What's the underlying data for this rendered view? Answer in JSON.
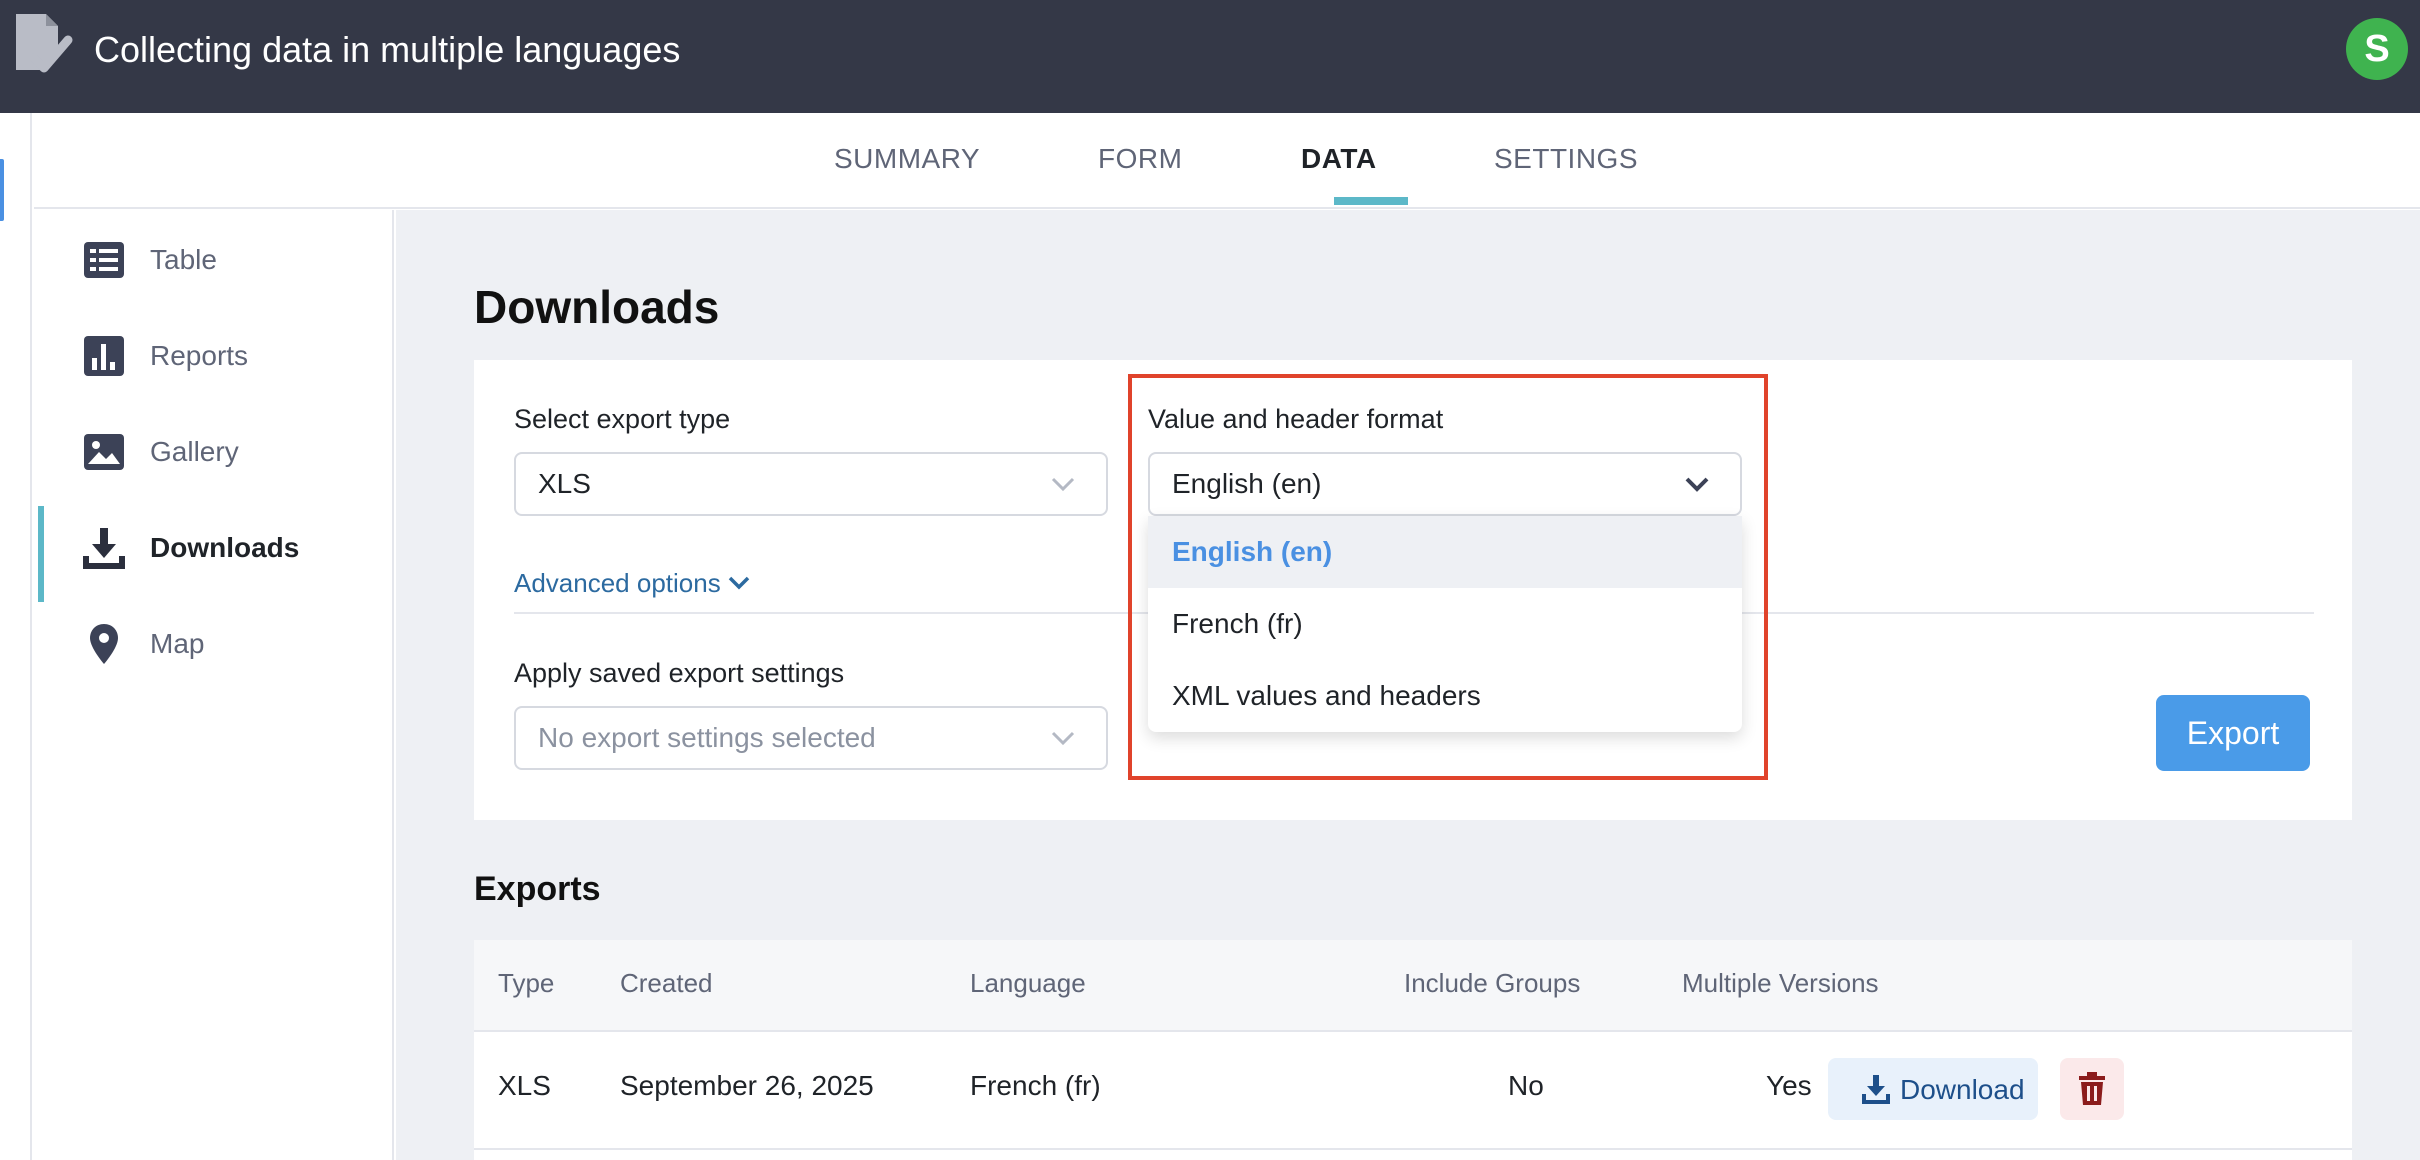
{
  "header": {
    "title": "Collecting data in multiple languages",
    "avatar_initial": "S",
    "logo_icon": "form-checkmark-icon"
  },
  "tabs": [
    {
      "label": "SUMMARY",
      "active": false
    },
    {
      "label": "FORM",
      "active": false
    },
    {
      "label": "DATA",
      "active": true
    },
    {
      "label": "SETTINGS",
      "active": false
    }
  ],
  "sidebar": {
    "items": [
      {
        "label": "Table",
        "icon": "table-icon",
        "active": false
      },
      {
        "label": "Reports",
        "icon": "bar-chart-icon",
        "active": false
      },
      {
        "label": "Gallery",
        "icon": "image-icon",
        "active": false
      },
      {
        "label": "Downloads",
        "icon": "download-icon",
        "active": true
      },
      {
        "label": "Map",
        "icon": "map-pin-icon",
        "active": false
      }
    ]
  },
  "downloads": {
    "title": "Downloads",
    "export_type": {
      "label": "Select export type",
      "value": "XLS"
    },
    "format": {
      "label": "Value and header format",
      "value": "English (en)",
      "options": [
        "English (en)",
        "French (fr)",
        "XML values and headers"
      ],
      "selected_index": 0
    },
    "advanced_options": "Advanced options",
    "saved_settings": {
      "label": "Apply saved export settings",
      "placeholder": "No export settings selected"
    },
    "export_button": "Export"
  },
  "exports": {
    "title": "Exports",
    "columns": [
      "Type",
      "Created",
      "Language",
      "Include Groups",
      "Multiple Versions"
    ],
    "rows": [
      {
        "type": "XLS",
        "created": "September 26, 2025",
        "language": "French (fr)",
        "include_groups": "No",
        "multiple_versions": "Yes"
      }
    ],
    "download_label": "Download"
  },
  "colors": {
    "topbar": "#343847",
    "accent": "#5cb8c8",
    "primary": "#4a9be8",
    "highlight": "#e0432b",
    "avatar": "#3fb34f"
  }
}
